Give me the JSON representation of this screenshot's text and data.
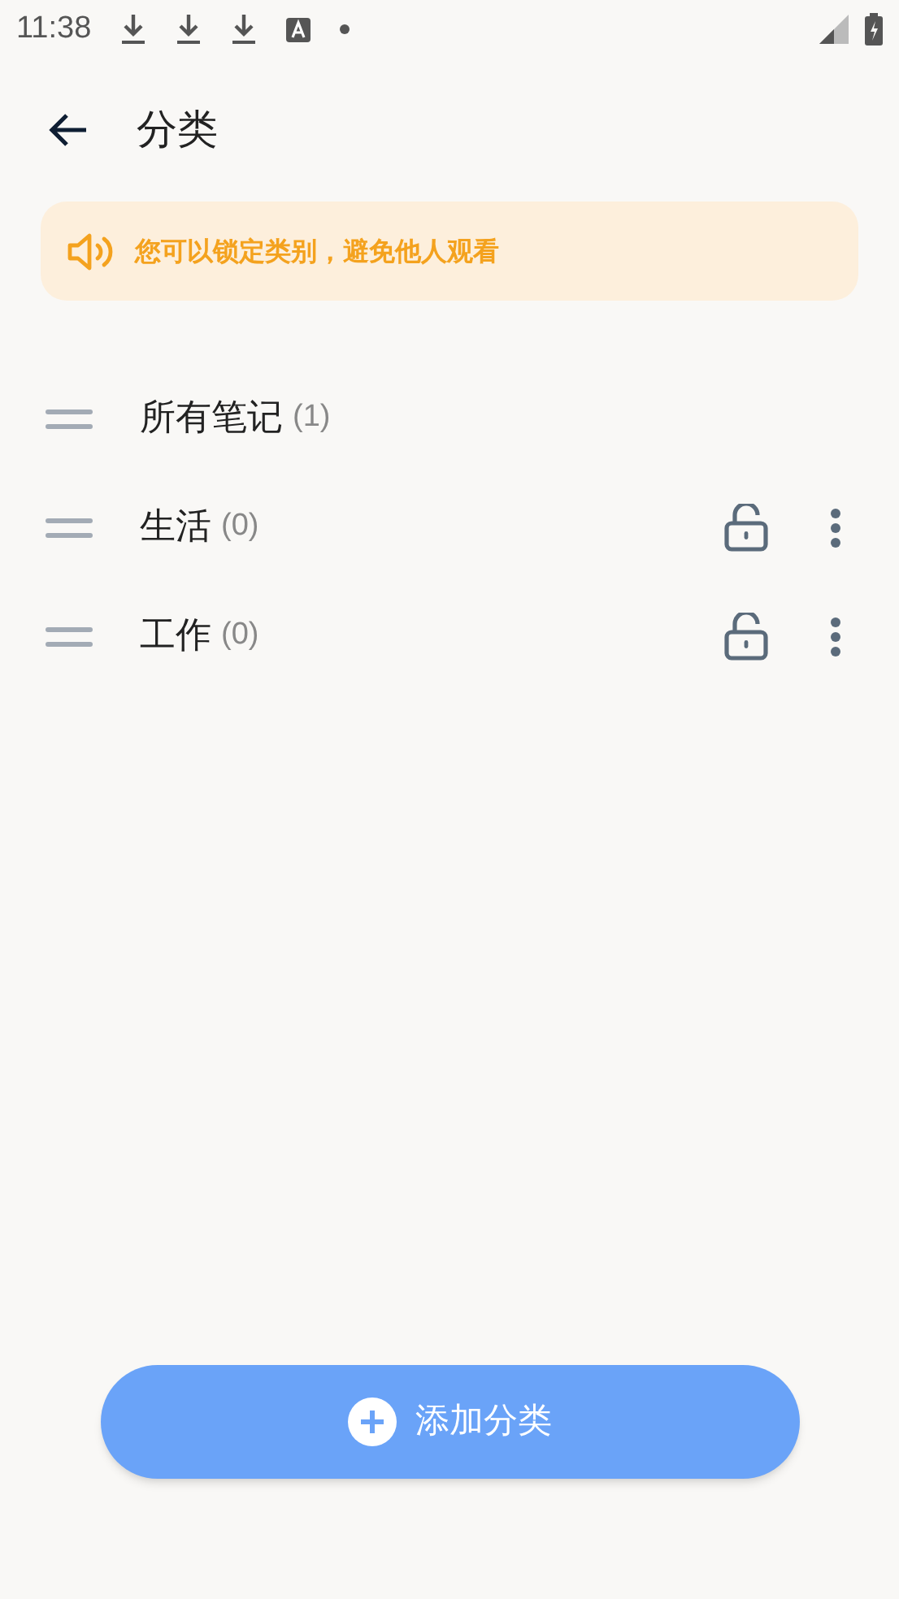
{
  "status_bar": {
    "time": "11:38"
  },
  "header": {
    "title": "分类"
  },
  "notice": {
    "text": "您可以锁定类别，避免他人观看"
  },
  "categories": [
    {
      "kind": "all",
      "name": "所有笔记",
      "count": "(1)"
    },
    {
      "kind": "category",
      "name": "生活",
      "count": "(0)",
      "locked": false
    },
    {
      "kind": "category",
      "name": "工作",
      "count": "(0)",
      "locked": false
    }
  ],
  "add_button": {
    "label": "添加分类"
  }
}
